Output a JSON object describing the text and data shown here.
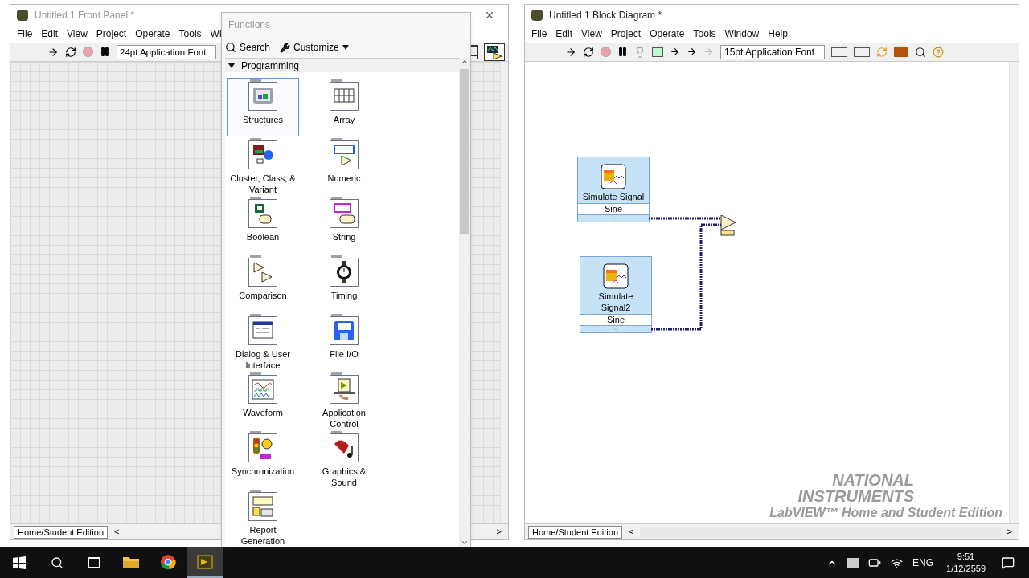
{
  "front_panel": {
    "title": "Untitled 1 Front Panel *",
    "menu": [
      "File",
      "Edit",
      "View",
      "Project",
      "Operate",
      "Tools",
      "Wi"
    ],
    "font": "24pt Application Font",
    "status": "Home/Student Edition",
    "scroll_left": "<",
    "scroll_right": ">"
  },
  "functions_palette": {
    "title": "Functions",
    "search": "Search",
    "customize": "Customize",
    "category": {
      "label": "Programming",
      "expanded": true
    },
    "items": [
      {
        "label": "Structures",
        "kind": "structures",
        "selected": true
      },
      {
        "label": "Array",
        "kind": "array",
        "selected": false
      },
      {
        "label": "Cluster, Class, & Variant",
        "kind": "cluster",
        "selected": false
      },
      {
        "label": "Numeric",
        "kind": "numeric",
        "selected": false
      },
      {
        "label": "Boolean",
        "kind": "boolean",
        "selected": false
      },
      {
        "label": "String",
        "kind": "string",
        "selected": false
      },
      {
        "label": "Comparison",
        "kind": "comparison",
        "selected": false
      },
      {
        "label": "Timing",
        "kind": "timing",
        "selected": false
      },
      {
        "label": "Dialog & User Interface",
        "kind": "dialog",
        "selected": false
      },
      {
        "label": "File I/O",
        "kind": "file",
        "selected": false
      },
      {
        "label": "Waveform",
        "kind": "waveform",
        "selected": false
      },
      {
        "label": "Application Control",
        "kind": "appcontrol",
        "selected": false
      },
      {
        "label": "Synchronization",
        "kind": "sync",
        "selected": false
      },
      {
        "label": "Graphics & Sound",
        "kind": "graphics",
        "selected": false
      },
      {
        "label": "Report Generation",
        "kind": "report",
        "selected": false
      }
    ]
  },
  "block_diagram": {
    "title": "Untitled 1 Block Diagram *",
    "menu": [
      "File",
      "Edit",
      "View",
      "Project",
      "Operate",
      "Tools",
      "Window",
      "Help"
    ],
    "font": "15pt Application Font",
    "nodes": [
      {
        "label": "Simulate Signal",
        "output": "Sine"
      },
      {
        "label": "Simulate Signal2",
        "output": "Sine"
      }
    ],
    "watermark": [
      "NATIONAL",
      "INSTRUMENTS",
      "LabVIEW™ Home and Student Edition"
    ],
    "status": "Home/Student Edition",
    "scroll_left": "<",
    "scroll_right": ">"
  },
  "taskbar": {
    "apps": [
      {
        "kind": "explorer",
        "active": false
      },
      {
        "kind": "browser",
        "active": false
      },
      {
        "kind": "labview",
        "active": true
      }
    ],
    "language": "ENG",
    "time": "9:51",
    "date": "1/12/2559"
  }
}
